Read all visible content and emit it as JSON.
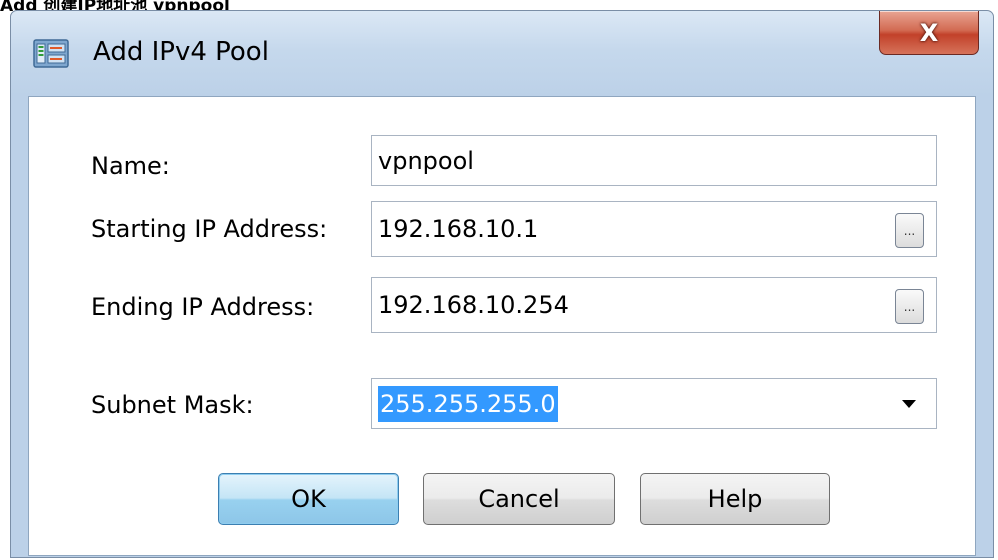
{
  "caption": "Add 创建IP地址池 vpnpool",
  "window": {
    "title": "Add IPv4 Pool",
    "close_label": "X",
    "icon": "network-pool-icon"
  },
  "form": {
    "name": {
      "label": "Name:",
      "value": "vpnpool"
    },
    "start_ip": {
      "label": "Starting IP Address:",
      "value": "192.168.10.1",
      "browse_label": "..."
    },
    "end_ip": {
      "label": "Ending IP Address:",
      "value": "192.168.10.254",
      "browse_label": "..."
    },
    "subnet": {
      "label": "Subnet Mask:",
      "value": "255.255.255.0"
    }
  },
  "buttons": {
    "ok": "OK",
    "cancel": "Cancel",
    "help": "Help"
  },
  "colors": {
    "selection": "#3399ff",
    "default_button": "#98d1ef",
    "close_button": "#c2412a"
  }
}
